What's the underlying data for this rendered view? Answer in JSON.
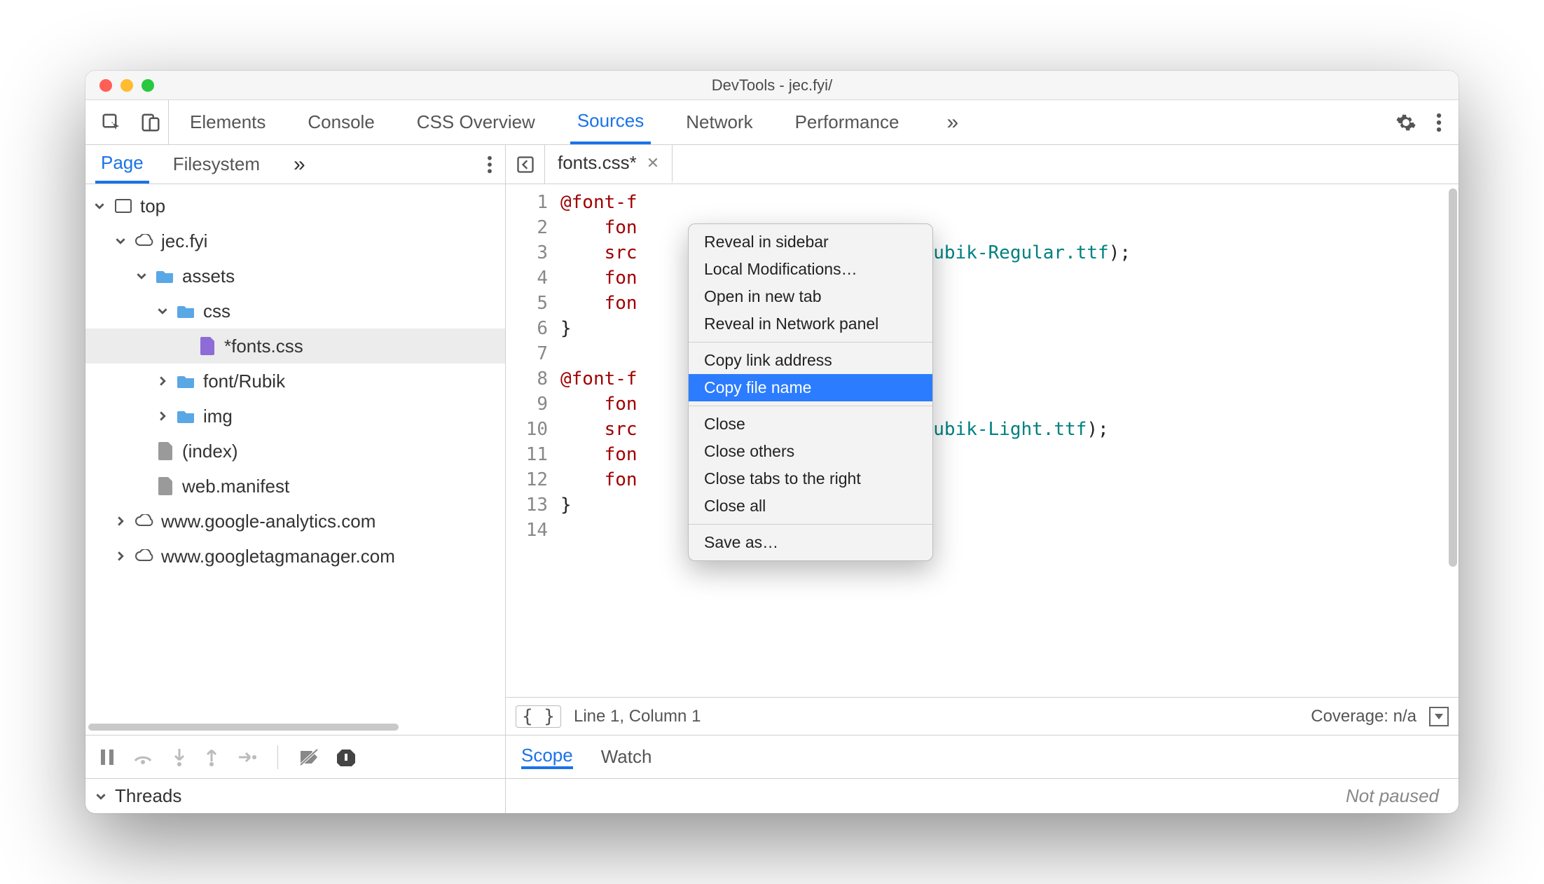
{
  "window": {
    "title": "DevTools - jec.fyi/"
  },
  "toolbar": {
    "tabs": [
      "Elements",
      "Console",
      "CSS Overview",
      "Sources",
      "Network",
      "Performance"
    ],
    "active": "Sources"
  },
  "navigator": {
    "tabs": [
      "Page",
      "Filesystem"
    ],
    "active": "Page"
  },
  "tree": [
    {
      "label": "top"
    },
    {
      "label": "jec.fyi"
    },
    {
      "label": "assets"
    },
    {
      "label": "css"
    },
    {
      "label": "*fonts.css",
      "selected": true
    },
    {
      "label": "font/Rubik"
    },
    {
      "label": "img"
    },
    {
      "label": "(index)"
    },
    {
      "label": "web.manifest"
    },
    {
      "label": "www.google-analytics.com"
    },
    {
      "label": "www.googletagmanager.com"
    }
  ],
  "editor": {
    "tab_label": "fonts.css*",
    "status_left": "Line 1, Column 1",
    "status_right": "Coverage: n/a"
  },
  "code": {
    "l1": "@font-f",
    "l2": "fon",
    "l3a": "src",
    "l3b": "Rubik/Rubik-Regular.ttf",
    "l3c": ");",
    "l4": "fon",
    "l5": "fon",
    "l6": "}",
    "l8": "@font-f",
    "l9": "fon",
    "l10a": "src",
    "l10b": "Rubik/Rubik-Light.ttf",
    "l10c": ");",
    "l11": "fon",
    "l12": "fon",
    "l13": "}"
  },
  "debugger": {
    "tabs": [
      "Scope",
      "Watch"
    ],
    "threads_label": "Threads",
    "not_paused": "Not paused"
  },
  "context_menu": [
    "Reveal in sidebar",
    "Local Modifications…",
    "Open in new tab",
    "Reveal in Network panel",
    "Copy link address",
    "Copy file name",
    "Close",
    "Close others",
    "Close tabs to the right",
    "Close all",
    "Save as…"
  ]
}
